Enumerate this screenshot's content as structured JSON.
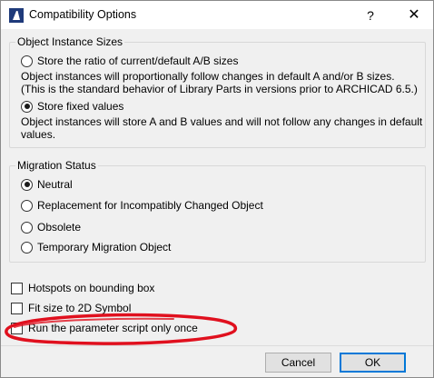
{
  "window": {
    "title": "Compatibility Options",
    "help_label": "?",
    "close_label": "✕",
    "icon": "archicad-app-icon"
  },
  "object_instance_sizes": {
    "label": "Object Instance Sizes",
    "options": [
      {
        "label": "Store the ratio of current/default A/B sizes",
        "checked": false,
        "description_line1": "Object instances will proportionally follow changes in default A and/or B sizes.",
        "description_line2": "(This is the standard behavior of Library Parts in versions prior to ARCHICAD 6.5.)"
      },
      {
        "label": "Store fixed values",
        "checked": true,
        "description_line1": "Object instances will store A and B values and will not follow any changes in default",
        "description_line2": "values."
      }
    ]
  },
  "migration_status": {
    "label": "Migration Status",
    "options": [
      {
        "label": "Neutral",
        "checked": true
      },
      {
        "label": "Replacement for Incompatibly Changed Object",
        "checked": false
      },
      {
        "label": "Obsolete",
        "checked": false
      },
      {
        "label": "Temporary Migration Object",
        "checked": false
      }
    ]
  },
  "checkboxes": [
    {
      "label": "Hotspots on bounding box",
      "checked": false
    },
    {
      "label": "Fit size to 2D Symbol",
      "checked": false
    },
    {
      "label": "Run the parameter script only once",
      "checked": false
    }
  ],
  "buttons": {
    "cancel_label": "Cancel",
    "ok_label": "OK"
  },
  "annotation": {
    "color": "#e0101e"
  }
}
